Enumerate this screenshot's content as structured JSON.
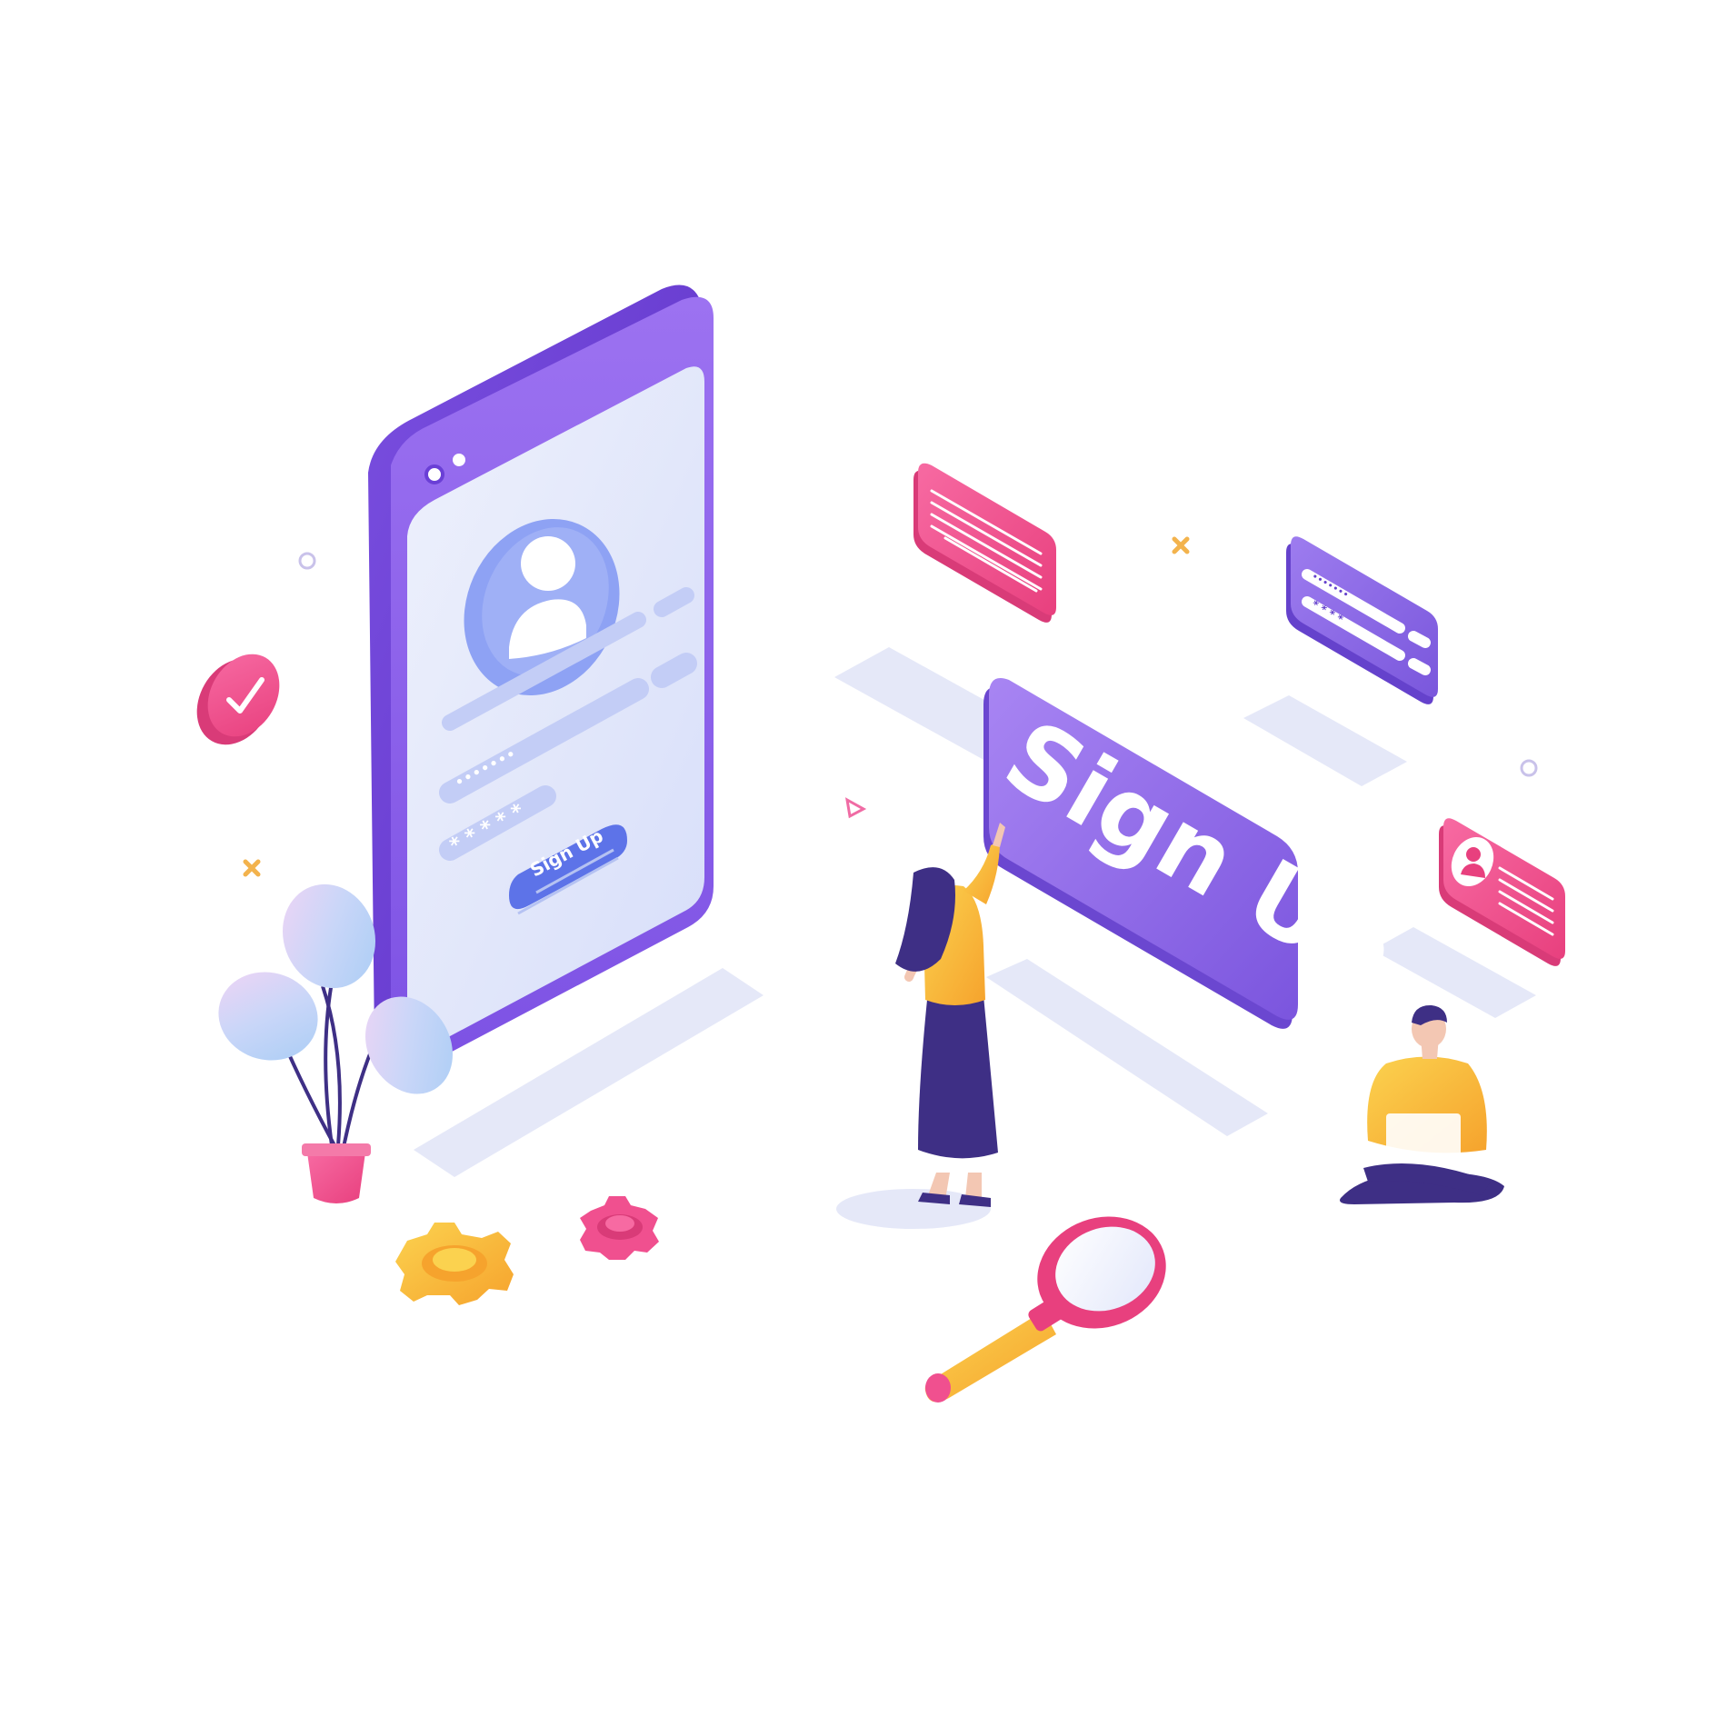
{
  "phone": {
    "password_mask": "•••••••",
    "pin_mask": "* * * * *",
    "signup_button_label": "Sign Up"
  },
  "big_button": {
    "label": "Sign Up"
  },
  "login_card": {
    "password_mask": "•••••••",
    "pin_mask": "* * * *"
  },
  "colors": {
    "primary_purple": "#8b63e8",
    "dark_purple": "#5b2fc4",
    "light_purple": "#b99df5",
    "pink": "#f0508f",
    "light_pink": "#f7a3c4",
    "yellow": "#f9bd3e",
    "orange": "#f7a632",
    "navy": "#3e2f85",
    "shadow": "#e4e6f7",
    "screen": "#e8edfb",
    "avatar_blue": "#8ea2f4"
  },
  "icons": {
    "checkmark_badge": "check-circle-icon",
    "user_avatar": "user-avatar-icon",
    "gear_large": "gear-icon",
    "gear_small": "gear-icon",
    "magnifier": "magnifying-glass-icon",
    "plant": "potted-plant-icon"
  }
}
